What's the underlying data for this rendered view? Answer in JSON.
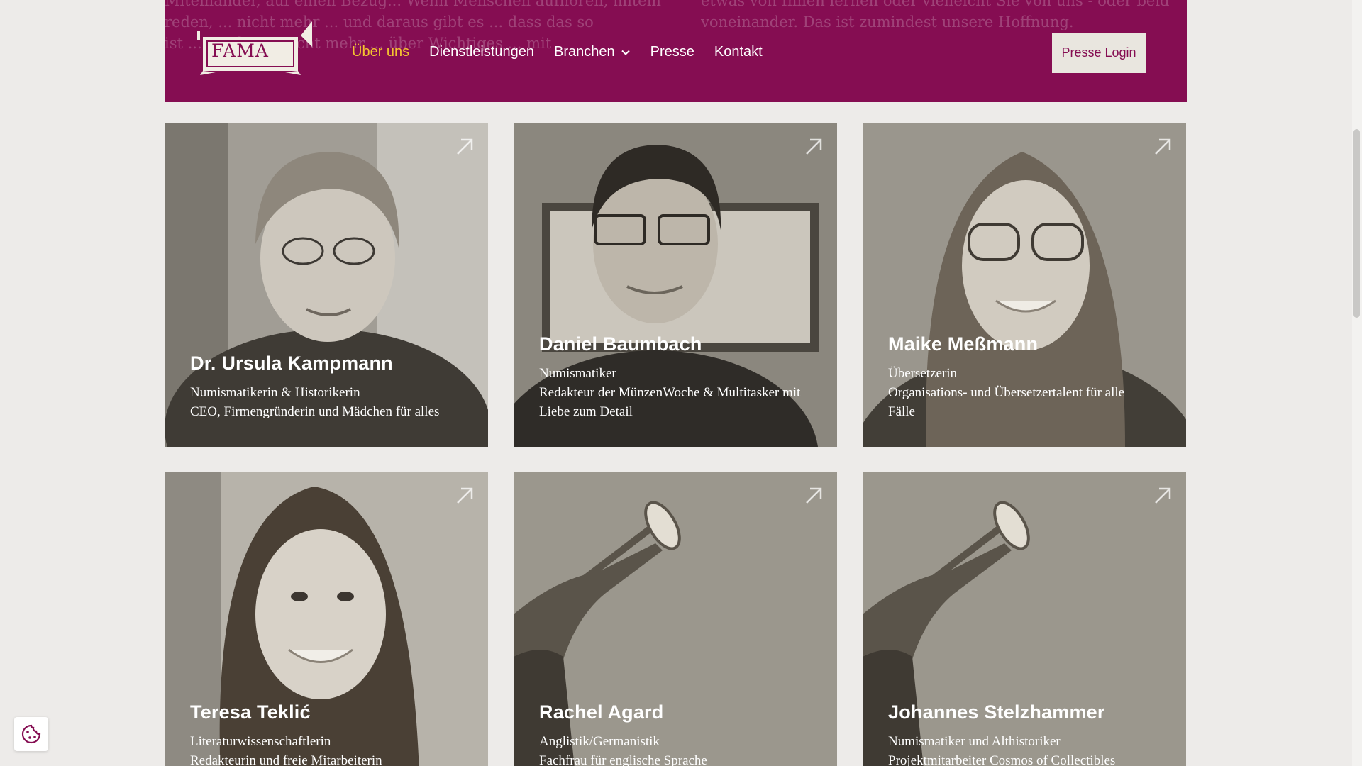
{
  "header": {
    "bg_text_left": [
      "Miteinander, auf einen Bezug... Wenn Menschen aufhören, miteinander zu",
      "reden, ... nicht mehr ... und daraus gibt es ... dass das so",
      "ist ... wieder ... nicht mehr ... über Wichtiges ... mit"
    ],
    "bg_text_right": [
      "etwas von Ihnen lernen oder vielleicht Sie von uns - oder beide",
      "voneinander. Das ist zumindest unsere Hoffnung."
    ],
    "logo_text": "FAMA",
    "nav": {
      "about": "Über uns",
      "services": "Dienstleistungen",
      "industries": "Branchen",
      "press": "Presse",
      "contact": "Kontakt"
    },
    "login_label": "Presse Login"
  },
  "team": [
    {
      "name": "Dr. Ursula Kampmann",
      "lines": [
        "Numismatikerin & Historikerin",
        "CEO, Firmengründerin und Mädchen für alles"
      ],
      "photo_icon": "portrait-woman-short-hair"
    },
    {
      "name": "Daniel Baumbach",
      "lines": [
        "Numismatiker",
        "Redakteur der MünzenWoche & Multitasker mit",
        "Liebe zum Detail"
      ],
      "photo_icon": "portrait-man-glasses"
    },
    {
      "name": "Maike Meßmann",
      "lines": [
        "Übersetzerin",
        "Organisations- und Übersetzertalent für alle",
        "Fälle"
      ],
      "photo_icon": "portrait-woman-glasses"
    },
    {
      "name": "Teresa Teklić",
      "lines": [
        "Literaturwissenschaftlerin",
        "Redakteurin und freie Mitarbeiterin"
      ],
      "photo_icon": "portrait-woman-long-hair"
    },
    {
      "name": "Rachel Agard",
      "lines": [
        "Anglistik/Germanistik",
        "Fachfrau für englische Sprache"
      ],
      "photo_icon": "trumpet-statue"
    },
    {
      "name": "Johannes Stelzhammer",
      "lines": [
        "Numismatiker und Althistoriker",
        "Projektmitarbeiter Cosmos of Collectibles"
      ],
      "photo_icon": "trumpet-statue"
    }
  ],
  "colors": {
    "brand": "#850d52",
    "nav_active": "#f4c430",
    "page_bg": "#edebe9"
  },
  "icons": {
    "cookie": "cookie-icon",
    "card_arrow": "arrow-up-right-icon",
    "chevron": "chevron-down-icon"
  }
}
